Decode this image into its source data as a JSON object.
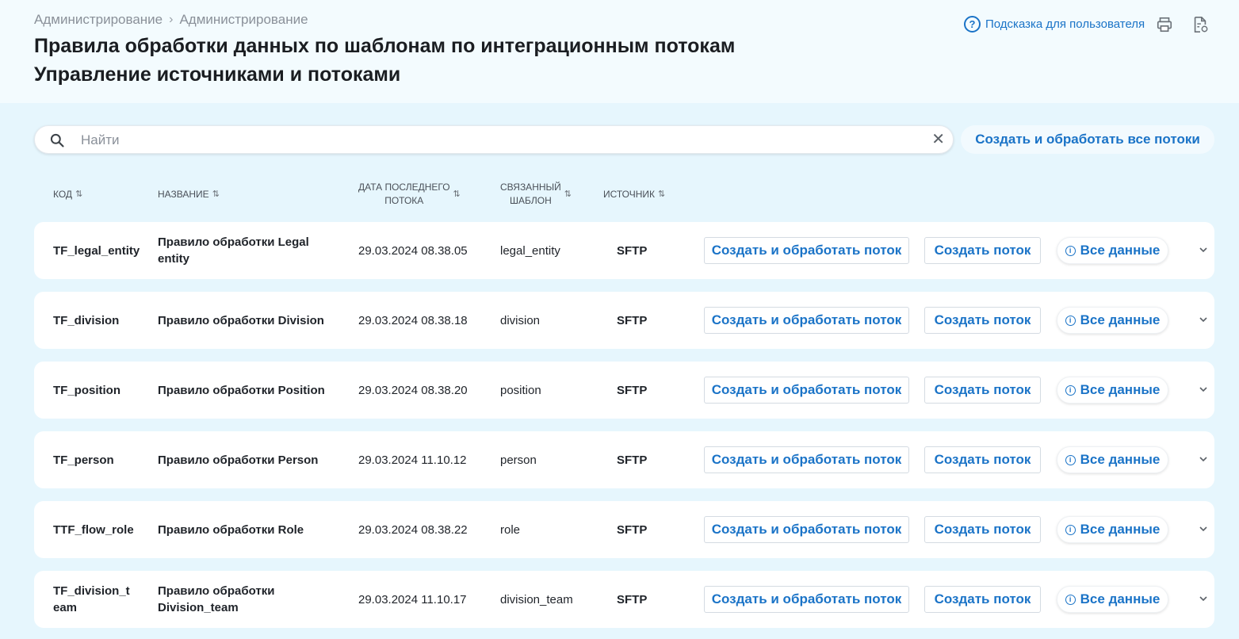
{
  "breadcrumb": [
    "Администрирование",
    "Администрирование"
  ],
  "page": {
    "title": "Правила обработки данных по шаблонам по интеграционным потокам",
    "subtitle": "Управление источниками и потоками"
  },
  "toolbar": {
    "help_label": "Подсказка для пользователя",
    "print_icon": "print-icon",
    "export_icon": "document-refresh-icon"
  },
  "search": {
    "placeholder": "Найти",
    "value": "",
    "clear_symbol": "✕"
  },
  "all_button_label": "Создать и обработать все потоки",
  "columns": {
    "code": "КОД",
    "name": "НАЗВАНИЕ",
    "date_line1": "ДАТА ПОСЛЕДНЕГО",
    "date_line2": "ПОТОКА",
    "template_line1": "СВЯЗАННЫЙ",
    "template_line2": "ШАБЛОН",
    "source": "ИСТОЧНИК"
  },
  "row_actions": {
    "create_process": "Создать и обработать поток",
    "create": "Создать поток",
    "all_data": "Все данные"
  },
  "rows": [
    {
      "code": "TF_legal_entity",
      "name": "Правило обработки Legal entity",
      "date": "29.03.2024 08.38.05",
      "template": "legal_entity",
      "source": "SFTP"
    },
    {
      "code": "TF_division",
      "name": "Правило обработки Division",
      "date": "29.03.2024 08.38.18",
      "template": "division",
      "source": "SFTP"
    },
    {
      "code": "TF_position",
      "name": "Правило обработки Position",
      "date": "29.03.2024 08.38.20",
      "template": "position",
      "source": "SFTP"
    },
    {
      "code": "TF_person",
      "name": "Правило обработки Person",
      "date": "29.03.2024 11.10.12",
      "template": "person",
      "source": "SFTP"
    },
    {
      "code": "TTF_flow_role",
      "name": "Правило обработки Role",
      "date": "29.03.2024 08.38.22",
      "template": "role",
      "source": "SFTP"
    },
    {
      "code": "TF_division_team",
      "name": "Правило обработки Division_team",
      "date": "29.03.2024 11.10.17",
      "template": "division_team",
      "source": "SFTP"
    }
  ],
  "colors": {
    "accent": "#1a73c7",
    "background": "#e6f6fd",
    "header_bg": "#f3fbfe"
  }
}
